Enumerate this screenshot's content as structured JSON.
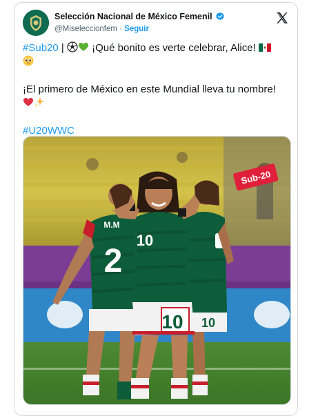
{
  "account": {
    "display_name": "Selección Nacional de México Femenil",
    "handle": "@Miseleccionfem",
    "separator": "·",
    "follow_label": "Seguir"
  },
  "tweet": {
    "line1_hashtag": "#Sub20",
    "line1_sep": " | ",
    "line1_text": " ¡Qué bonito es verte celebrar, Alice! ",
    "line2_text": "¡El primero de México en este Mundial lleva tu nombre!",
    "line3_hashtag": "#U20WWC"
  },
  "photo": {
    "badge_text": "Sub-20",
    "jersey_name_left": "M.M",
    "jersey_number_left": "2",
    "jersey_number_center": "10",
    "shorts_number_center": "10",
    "shorts_number_right": "10"
  },
  "icons": {
    "verified": "verified-badge-icon",
    "platform": "x-logo-icon"
  },
  "colors": {
    "accent": "#1d9bf0",
    "text": "#0f1419",
    "muted": "#536471",
    "border": "#cfd9de",
    "jersey_green": "#0d5c3a",
    "badge_red": "#e0203a"
  }
}
